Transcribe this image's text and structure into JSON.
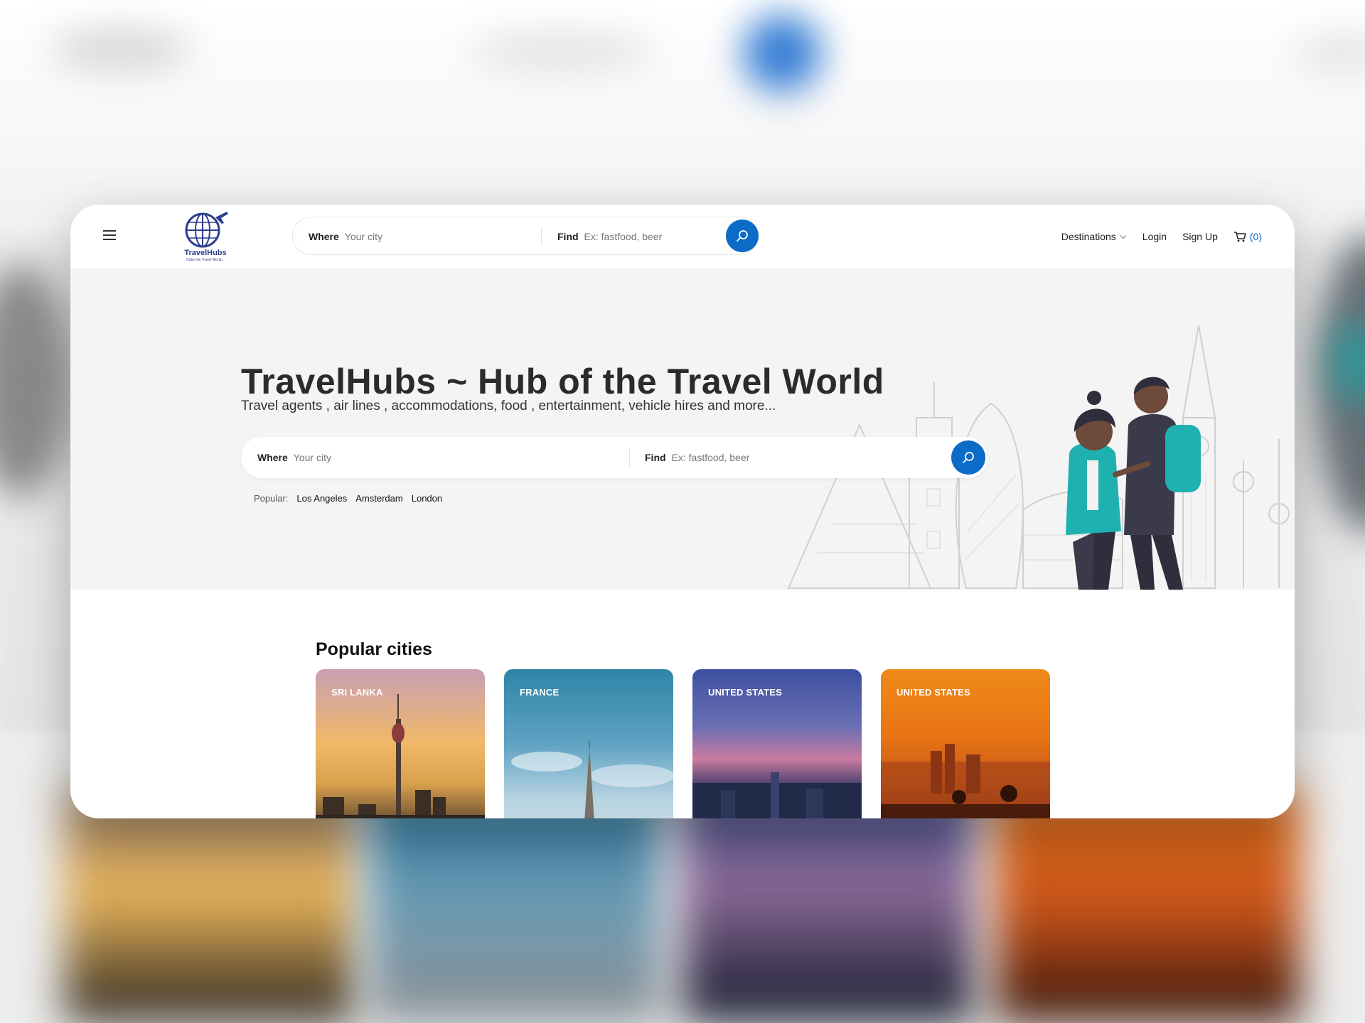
{
  "brand": {
    "name": "TravelHubs",
    "tagline": "Hubs the Travel World..."
  },
  "nav": {
    "search": {
      "where_label": "Where",
      "where_placeholder": "Your city",
      "find_label": "Find",
      "find_placeholder": "Ex: fastfood, beer"
    },
    "links": {
      "destinations": "Destinations",
      "login": "Login",
      "signup": "Sign Up",
      "cart_count": "(0)"
    }
  },
  "hero": {
    "title": "TravelHubs ~ Hub of the Travel World",
    "subtitle": "Travel agents , air lines , accommodations, food , entertainment, vehicle hires and more...",
    "search": {
      "where_label": "Where",
      "where_placeholder": "Your city",
      "find_label": "Find",
      "find_placeholder": "Ex: fastfood, beer"
    },
    "popular_label": "Popular:",
    "popular_cities": [
      "Los Angeles",
      "Amsterdam",
      "London"
    ]
  },
  "popular_section": {
    "title": "Popular cities",
    "cities": [
      {
        "country": "SRI LANKA"
      },
      {
        "country": "FRANCE"
      },
      {
        "country": "UNITED STATES"
      },
      {
        "country": "UNITED STATES"
      }
    ]
  },
  "colors": {
    "accent": "#0c6bc6",
    "hero_bg": "#f4f4f4",
    "text_dark": "#2b2b2b"
  },
  "icons": [
    "hamburger-icon",
    "search-icon",
    "chevron-down-icon",
    "cart-icon",
    "globe-logo-icon"
  ]
}
